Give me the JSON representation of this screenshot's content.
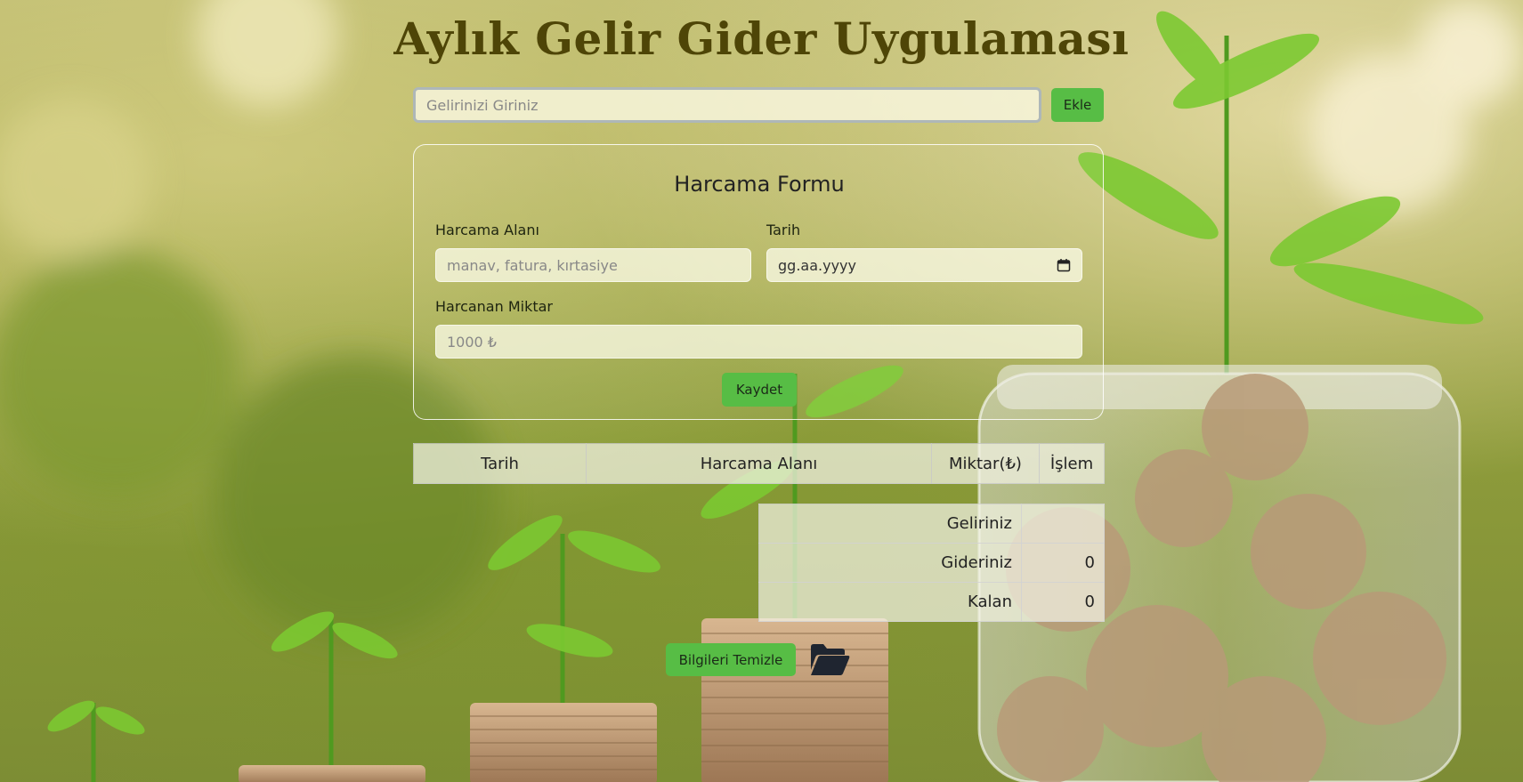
{
  "title": "Aylık Gelir Gider Uygulaması",
  "income": {
    "placeholder": "Gelirinizi Giriniz",
    "add_label": "Ekle"
  },
  "form": {
    "title": "Harcama Formu",
    "area_label": "Harcama Alanı",
    "area_placeholder": "manav, fatura, kırtasiye",
    "date_label": "Tarih",
    "date_value": "gg.aa.yyyy",
    "amount_label": "Harcanan Miktar",
    "amount_placeholder": "1000 ₺",
    "save_label": "Kaydet"
  },
  "table": {
    "headers": [
      "Tarih",
      "Harcama Alanı",
      "Miktar(₺)",
      "İşlem"
    ]
  },
  "summary": {
    "rows": [
      {
        "label": "Geliriniz",
        "value": ""
      },
      {
        "label": "Gideriniz",
        "value": "0"
      },
      {
        "label": "Kalan",
        "value": "0"
      }
    ]
  },
  "actions": {
    "clear_label": "Bilgileri Temizle",
    "folder_icon": "folder-open-icon"
  },
  "colors": {
    "accent": "#57bd45",
    "title": "#4e4507"
  }
}
